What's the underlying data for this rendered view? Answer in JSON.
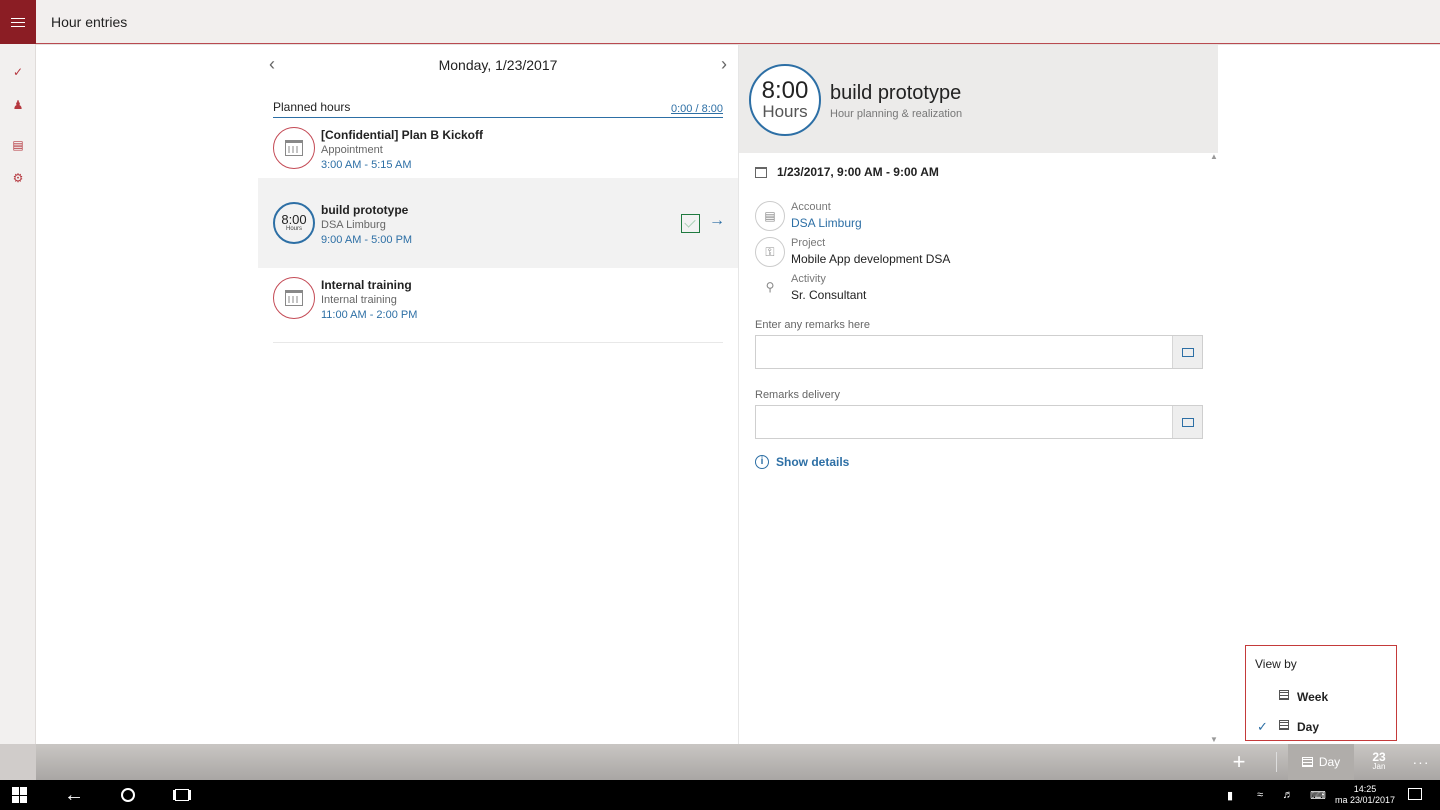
{
  "app": {
    "title": "Hour entries"
  },
  "rail": {
    "icons": [
      "checkmark-circle-icon",
      "person-icon",
      "document-icon",
      "settings-icon"
    ]
  },
  "list": {
    "date": "Monday, 1/23/2017",
    "planned_label": "Planned hours",
    "planned_value": "0:00 / 8:00",
    "entries": [
      {
        "title": "[Confidential] Plan B Kickoff",
        "subtitle": "Appointment",
        "time": "3:00 AM - 5:15 AM",
        "icon": "calendar-icon"
      },
      {
        "title": "build prototype",
        "subtitle": "DSA Limburg",
        "time": "9:00 AM - 5:00 PM",
        "hours": "8:00",
        "hours_label": "Hours",
        "selected": true
      },
      {
        "title": "Internal training",
        "subtitle": "Internal training",
        "time": "11:00 AM - 2:00 PM",
        "icon": "calendar-icon"
      }
    ]
  },
  "detail": {
    "hours": "8:00",
    "hours_label": "Hours",
    "title": "build prototype",
    "subtitle": "Hour planning & realization",
    "datetime": "1/23/2017, 9:00 AM - 9:00 AM",
    "account_label": "Account",
    "account_value": "DSA Limburg",
    "project_label": "Project",
    "project_value": "Mobile App development DSA",
    "activity_label": "Activity",
    "activity_value": "Sr. Consultant",
    "remarks_label": "Enter any remarks here",
    "remarks_value": "",
    "delivery_label": "Remarks delivery",
    "delivery_value": "",
    "show_details": "Show details"
  },
  "viewby": {
    "title": "View by",
    "options": [
      {
        "label": "Week",
        "checked": false
      },
      {
        "label": "Day",
        "checked": true
      }
    ]
  },
  "commandbar": {
    "view_label": "Day",
    "date_day": "23",
    "date_month": "Jan"
  },
  "taskbar": {
    "time": "14:25",
    "date": "ma 23/01/2017"
  },
  "colors": {
    "accent": "#8b1d24",
    "link": "#2d6fa5",
    "highlight": "#c43a3a",
    "ok": "#1f7a3f"
  }
}
